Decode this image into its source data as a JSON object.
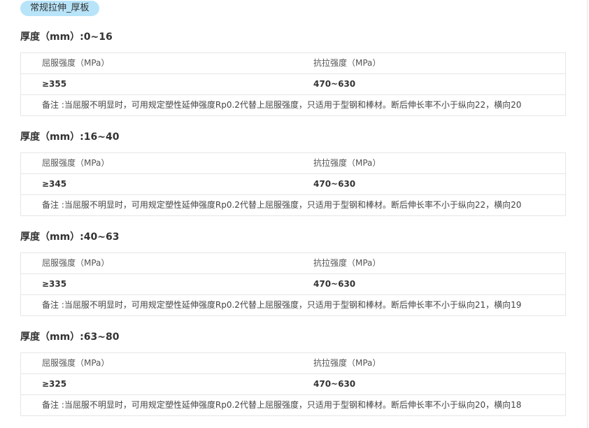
{
  "category_tag": "常规拉伸_厚板",
  "sections": [
    {
      "title": "厚度（mm）:0~16",
      "yield_label": "屈服强度（MPa）",
      "tensile_label": "抗拉强度（MPa）",
      "yield_value": "≥355",
      "tensile_value": "470~630",
      "note": "备注 :当屈服不明显时，可用规定塑性延伸强度Rp0.2代替上屈服强度，只适用于型钢和棒材。断后伸长率不小于纵向22，横向20"
    },
    {
      "title": "厚度（mm）:16~40",
      "yield_label": "屈服强度（MPa）",
      "tensile_label": "抗拉强度（MPa）",
      "yield_value": "≥345",
      "tensile_value": "470~630",
      "note": "备注 :当屈服不明显时，可用规定塑性延伸强度Rp0.2代替上屈服强度，只适用于型钢和棒材。断后伸长率不小于纵向22，横向20"
    },
    {
      "title": "厚度（mm）:40~63",
      "yield_label": "屈服强度（MPa）",
      "tensile_label": "抗拉强度（MPa）",
      "yield_value": "≥335",
      "tensile_value": "470~630",
      "note": "备注 :当屈服不明显时，可用规定塑性延伸强度Rp0.2代替上屈服强度，只适用于型钢和棒材。断后伸长率不小于纵向21，横向19"
    },
    {
      "title": "厚度（mm）:63~80",
      "yield_label": "屈服强度（MPa）",
      "tensile_label": "抗拉强度（MPa）",
      "yield_value": "≥325",
      "tensile_value": "470~630",
      "note": "备注 :当屈服不明显时，可用规定塑性延伸强度Rp0.2代替上屈服强度，只适用于型钢和棒材。断后伸长率不小于纵向20，横向18"
    }
  ],
  "colors": {
    "tag_background": "#b8e4f9",
    "border": "#e6e6e6",
    "text": "#333333"
  }
}
